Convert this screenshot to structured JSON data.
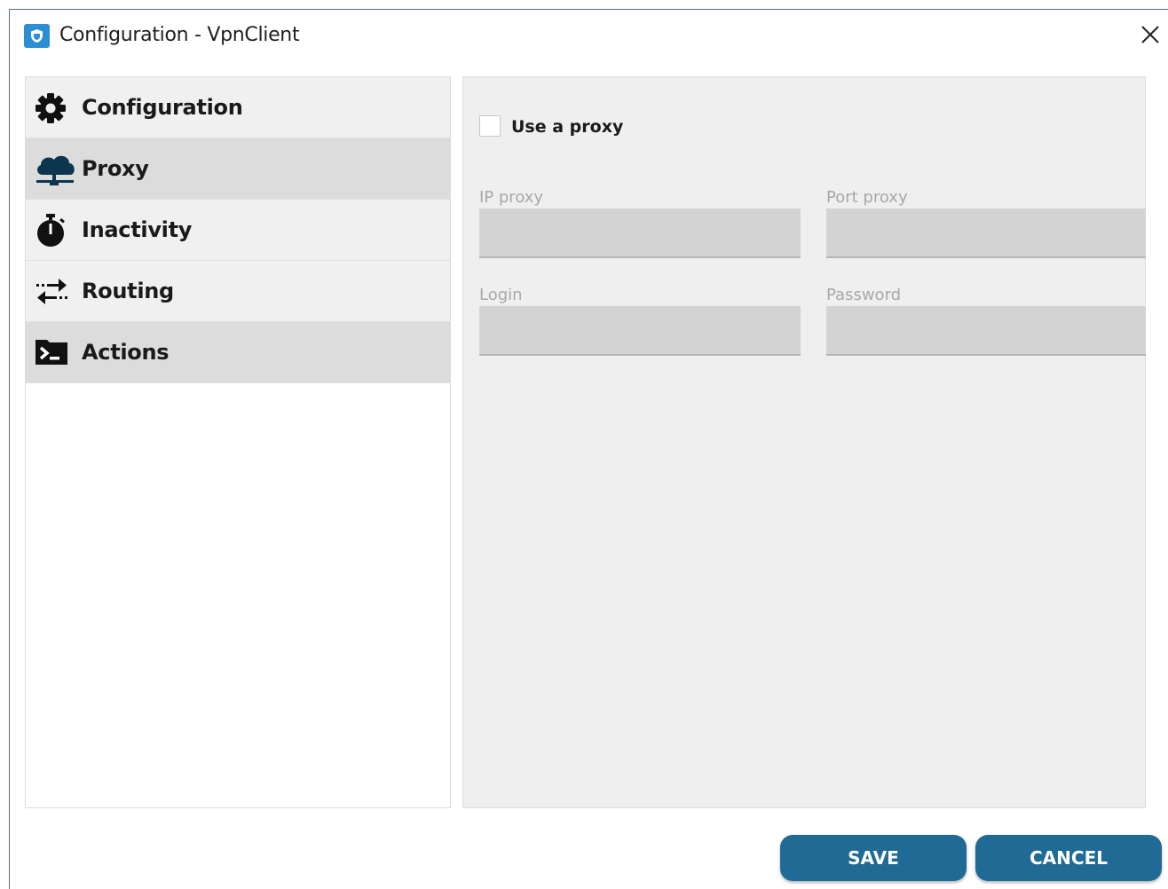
{
  "window": {
    "title": "Configuration - VpnClient",
    "app_icon": "shield-icon",
    "close_icon": "close-icon"
  },
  "sidebar": {
    "items": [
      {
        "label": "Configuration",
        "icon": "gear-icon",
        "active": false
      },
      {
        "label": "Proxy",
        "icon": "cloud-network-icon",
        "active": true
      },
      {
        "label": "Inactivity",
        "icon": "stopwatch-icon",
        "active": false
      },
      {
        "label": "Routing",
        "icon": "swap-arrows-icon",
        "active": false
      },
      {
        "label": "Actions",
        "icon": "terminal-icon",
        "active": true
      }
    ]
  },
  "proxy": {
    "use_proxy_label": "Use a proxy",
    "use_proxy_checked": false,
    "ip_label": "IP proxy",
    "ip_value": "",
    "port_label": "Port proxy",
    "port_value": "",
    "login_label": "Login",
    "login_value": "",
    "password_label": "Password",
    "password_value": ""
  },
  "buttons": {
    "save": "SAVE",
    "cancel": "CANCEL"
  },
  "colors": {
    "accent": "#1f6b96",
    "app_icon": "#2c8fd3",
    "active_nav": "#dcdcdc",
    "panel_bg": "#efefef"
  }
}
